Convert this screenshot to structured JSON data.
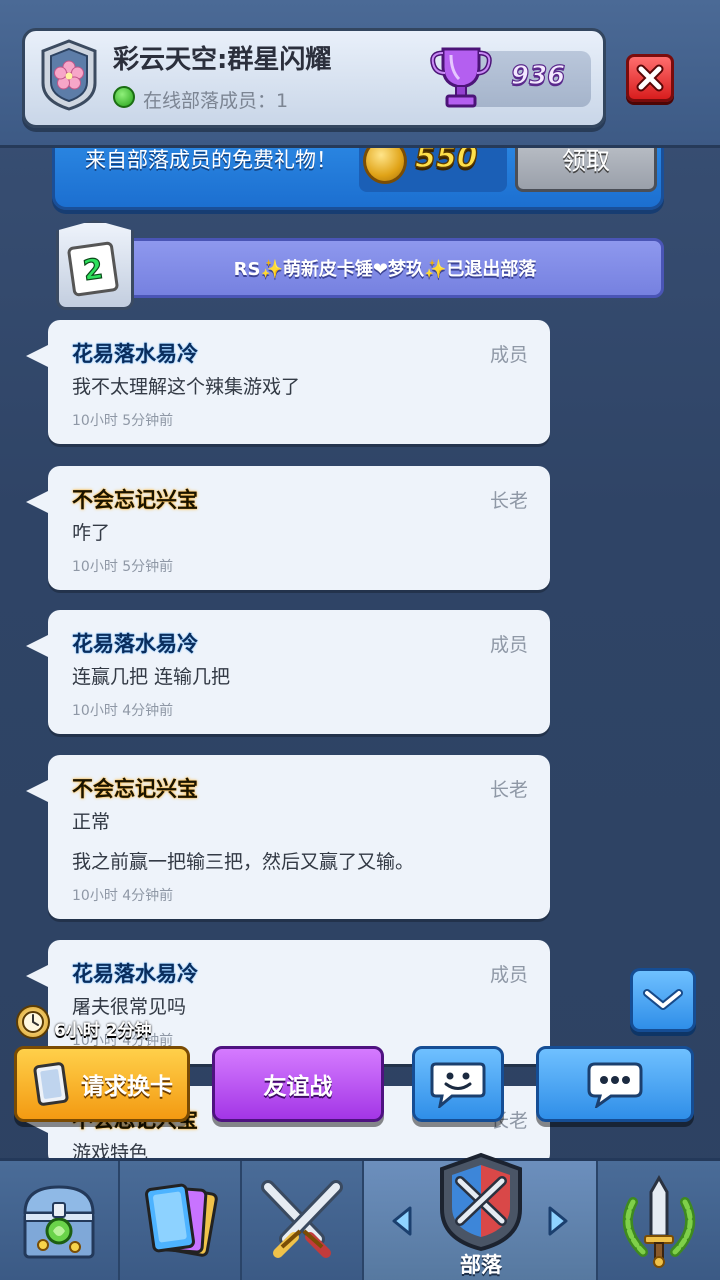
{
  "header": {
    "clan_name": "彩云天空:群星闪耀",
    "online_label": "在线部落成员：1",
    "trophies": "936",
    "close_icon": "close-icon"
  },
  "gift": {
    "text": "来自部落成员的免费礼物！",
    "amount": "550",
    "claim_label": "领取"
  },
  "notice": {
    "level": "2",
    "text": "RS✨萌新皮卡锤❤梦玖✨已退出部落"
  },
  "messages": [
    {
      "name": "花易落水易冷",
      "role": "成员",
      "lines": [
        "我不太理解这个辣集游戏了"
      ],
      "time": "10小时 5分钟前"
    },
    {
      "name": "不会忘记兴宝",
      "role": "长老",
      "lines": [
        "咋了"
      ],
      "time": "10小时 5分钟前"
    },
    {
      "name": "花易落水易冷",
      "role": "成员",
      "lines": [
        "连赢几把 连输几把"
      ],
      "time": "10小时 4分钟前"
    },
    {
      "name": "不会忘记兴宝",
      "role": "长老",
      "lines": [
        "正常",
        "我之前赢一把输三把，然后又赢了又输。"
      ],
      "time": "10小时 4分钟前"
    },
    {
      "name": "花易落水易冷",
      "role": "成员",
      "lines": [
        "屠夫很常见吗"
      ],
      "time": "10小时 4分钟前"
    },
    {
      "name": "不会忘记兴宝",
      "role": "长老",
      "lines": [
        "游戏特色"
      ],
      "time": ""
    }
  ],
  "timer": "6小时 2分钟",
  "actions": {
    "request_card": "请求换卡",
    "friendly_battle": "友谊战"
  },
  "nav": {
    "clan_label": "部落",
    "active_tab": "clan"
  },
  "colors": {
    "member_name": "#0a2d5c",
    "elder_name": "#1a1400",
    "accent_blue": "#2f8ee8",
    "request_orange": "#f39a12",
    "battle_purple": "#a336e6"
  }
}
